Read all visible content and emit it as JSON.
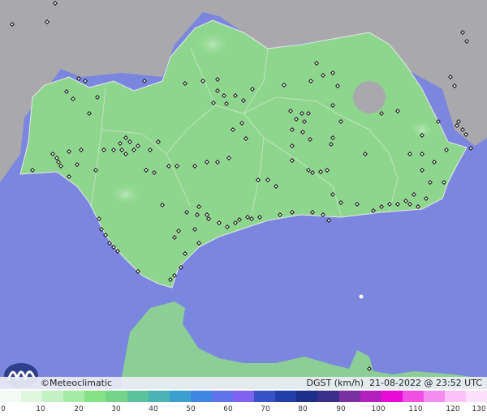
{
  "brand": "©Meteoclimatic",
  "variable": "DGST (km/h)",
  "timestamp": "21-08-2022 @ 23:52 UTC",
  "legend": {
    "ticks": [
      "0",
      "10",
      "20",
      "30",
      "40",
      "50",
      "60",
      "70",
      "80",
      "90",
      "100",
      "110",
      "120",
      "130"
    ],
    "colors": [
      "#f4fbf4",
      "#dff6df",
      "#c3f1c3",
      "#a5eaa5",
      "#85e285",
      "#74d48a",
      "#5bc39b",
      "#49b3b5",
      "#3aa0cf",
      "#3f86e0",
      "#5f73ea",
      "#7f62f0",
      "#3a52c8",
      "#233fa8",
      "#1c2f8a",
      "#3a2f8a",
      "#7a2fa0",
      "#b41fbf",
      "#e80bd8",
      "#f04fe6",
      "#f58cef",
      "#fac2f7",
      "#fde0fb"
    ]
  },
  "colors": {
    "sea": "#7b86df",
    "land": "#8ed68e",
    "neighbour_land": "#a9a9ad",
    "border": "#e8e8e8",
    "station": "#111111"
  },
  "icons": {
    "logo": "meteoclimatic-wave-logo",
    "station": "station-diamond-icon"
  }
}
